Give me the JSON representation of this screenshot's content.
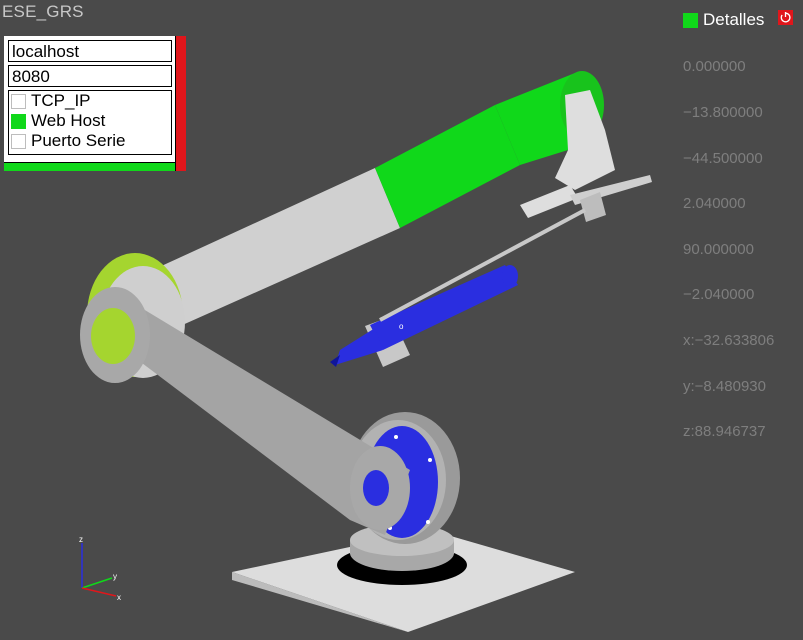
{
  "app_title": "ESE_GRS",
  "connection": {
    "host": "localhost",
    "port": "8080",
    "options": [
      {
        "label": "TCP_IP",
        "checked": false
      },
      {
        "label": "Web Host",
        "checked": true
      },
      {
        "label": "Puerto Serie",
        "checked": false
      }
    ]
  },
  "details": {
    "label": "Detalles",
    "checked": true,
    "values": [
      "0.000000",
      "−13.800000",
      "−44.500000",
      "2.040000",
      "90.000000",
      "−2.040000",
      "x:−32.633806",
      "y:−8.480930",
      "z:88.946737"
    ]
  },
  "axes": {
    "x": "x",
    "y": "y",
    "z": "z"
  },
  "colors": {
    "background": "#4a4a4a",
    "accent_green": "#10d81a",
    "accent_red": "#e0161b",
    "joint_blue": "#2a2ee0",
    "arm_gray": "#c8c8c8"
  }
}
